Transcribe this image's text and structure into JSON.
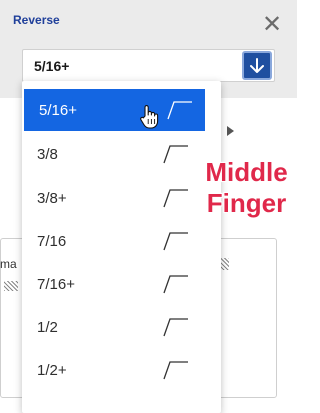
{
  "dialog": {
    "title": "Reverse",
    "close_symbol": "✕",
    "select": {
      "value": "5/16+"
    }
  },
  "background": {
    "text_fragment": "ma"
  },
  "dropdown": {
    "selected_index": 0,
    "options": [
      {
        "label": "5/16+"
      },
      {
        "label": "3/8"
      },
      {
        "label": "3/8+"
      },
      {
        "label": "7/16"
      },
      {
        "label": "7/16+"
      },
      {
        "label": "1/2"
      },
      {
        "label": "1/2+"
      }
    ]
  },
  "annotation": {
    "line1": "Middle",
    "line2": "Finger"
  },
  "colors": {
    "accent": "#1466e2",
    "title": "#1f3f9a",
    "annotation": "#e0284a",
    "arrow_button": "#1f4fa0"
  },
  "icons": [
    "close-icon",
    "arrow-down-icon",
    "step-glyph-icon",
    "hand-cursor-icon"
  ]
}
